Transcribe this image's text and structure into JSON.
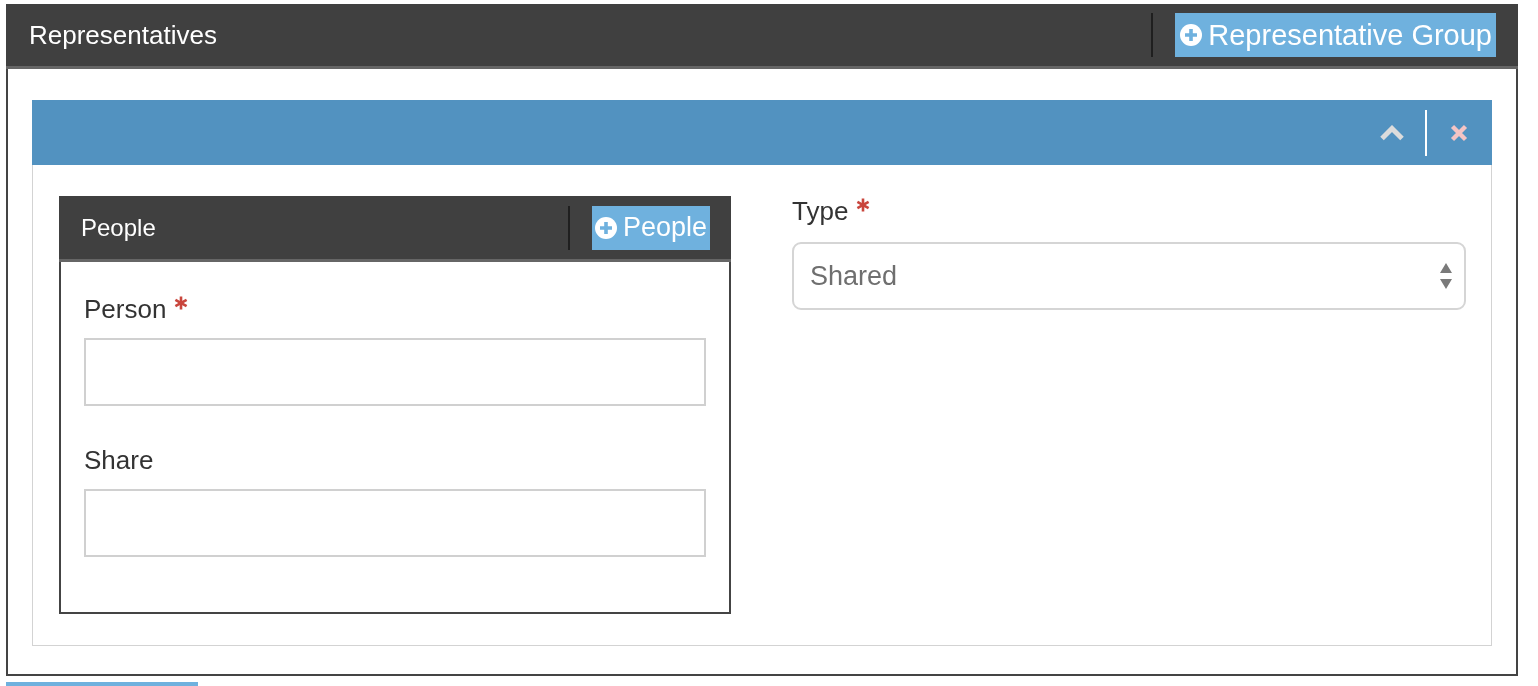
{
  "panel": {
    "title": "Representatives",
    "add_button": {
      "label": "Representative Group"
    }
  },
  "group": {
    "people": {
      "title": "People",
      "add_button": {
        "label": "People"
      },
      "fields": [
        {
          "label": "Person",
          "required": true
        },
        {
          "label": "Share",
          "required": false
        }
      ]
    },
    "type_field": {
      "label": "Type",
      "required": true,
      "value": "Shared"
    }
  }
}
